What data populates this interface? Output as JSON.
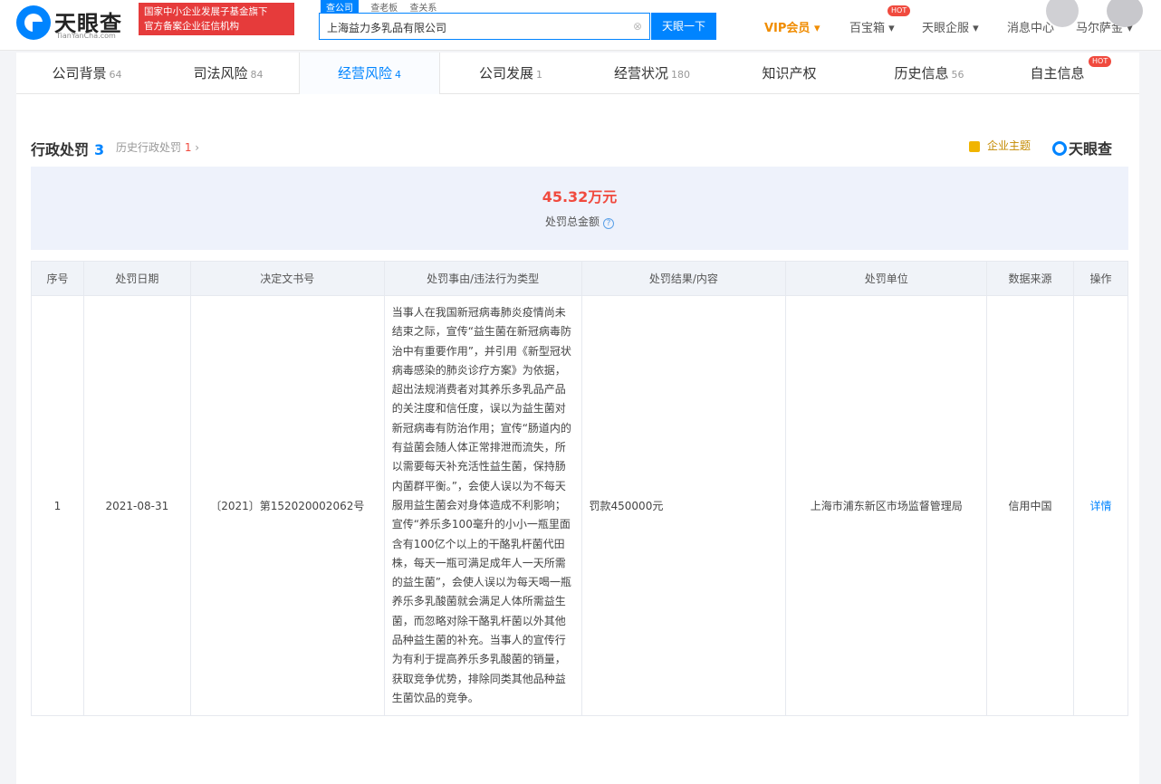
{
  "header": {
    "logo_text": "天眼查",
    "logo_sub": "TianYanCha.com",
    "banner_line1": "国家中小企业发展子基金旗下",
    "banner_line2": "官方备案企业征信机构",
    "search_tabs": [
      "查公司",
      "查老板",
      "查关系"
    ],
    "search_value": "上海益力多乳品有限公司",
    "search_button": "天眼一下",
    "nav": {
      "vip": "VIP会员 ▾",
      "baibao": "百宝箱 ▾",
      "baibao_badge": "HOT",
      "qiye": "天眼企服 ▾",
      "msg": "消息中心",
      "user": "马尔萨金 ▾"
    }
  },
  "tabs": [
    {
      "label": "公司背景",
      "count": "64"
    },
    {
      "label": "司法风险",
      "count": "84"
    },
    {
      "label": "经营风险",
      "count": "4"
    },
    {
      "label": "公司发展",
      "count": "1"
    },
    {
      "label": "经营状况",
      "count": "180"
    },
    {
      "label": "知识产权",
      "count": ""
    },
    {
      "label": "历史信息",
      "count": "56"
    },
    {
      "label": "自主信息",
      "count": ""
    }
  ],
  "tab_badge": "HOT",
  "section": {
    "title": "行政处罚",
    "count": "3",
    "history_label": "历史行政处罚",
    "history_count": "1",
    "brand_lock": "企业主题",
    "brand_logo": "天眼查"
  },
  "summary": {
    "amount": "45.32万元",
    "label": "处罚总金额"
  },
  "table": {
    "headers": [
      "序号",
      "处罚日期",
      "决定文书号",
      "处罚事由/违法行为类型",
      "处罚结果/内容",
      "处罚单位",
      "数据来源",
      "操作"
    ],
    "rows": [
      {
        "index": "1",
        "date": "2021-08-31",
        "doc_no": "〔2021〕第152020002062号",
        "reason": "当事人在我国新冠病毒肺炎疫情尚未结束之际，宣传“益生菌在新冠病毒防治中有重要作用”，并引用《新型冠状病毒感染的肺炎诊疗方案》为依据，超出法规消费者对其养乐多乳品产品的关注度和信任度，误以为益生菌对新冠病毒有防治作用；宣传“肠道内的有益菌会随人体正常排泄而流失，所以需要每天补充活性益生菌，保持肠内菌群平衡。”，会使人误以为不每天服用益生菌会对身体造成不利影响；宣传“养乐多100毫升的小小一瓶里面含有100亿个以上的干酪乳杆菌代田株，每天一瓶可满足成年人一天所需的益生菌”，会使人误以为每天喝一瓶养乐多乳酸菌就会满足人体所需益生菌，而忽略对除干酪乳杆菌以外其他品种益生菌的补充。当事人的宣传行为有利于提高养乐多乳酸菌的销量，获取竞争优势，排除同类其他品种益生菌饮品的竞争。",
        "result": "罚款450000元",
        "unit": "上海市浦东新区市场监督管理局",
        "source": "信用中国",
        "action": "详情"
      }
    ]
  }
}
